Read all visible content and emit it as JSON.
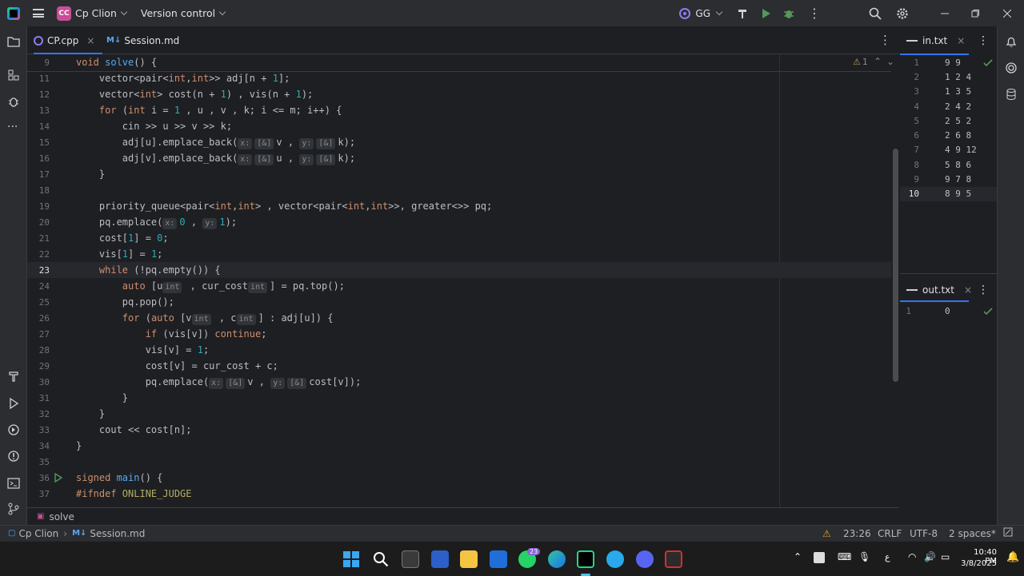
{
  "titlebar": {
    "project_badge": "CC",
    "project_name": "Cp Clion",
    "vcs": "Version control",
    "user_badge": "GG"
  },
  "tabs": [
    {
      "label": "CP.cpp",
      "active": true
    },
    {
      "label": "Session.md",
      "active": false
    }
  ],
  "editor": {
    "warning_count": "1",
    "line_numbers": [
      "9",
      "11",
      "12",
      "13",
      "14",
      "15",
      "16",
      "17",
      "18",
      "19",
      "20",
      "21",
      "22",
      "23",
      "24",
      "25",
      "26",
      "27",
      "28",
      "29",
      "30",
      "31",
      "32",
      "33",
      "34",
      "35",
      "36",
      "37"
    ],
    "current_line": "23"
  },
  "code": {
    "l9_a": "void ",
    "l9_fn": "solve",
    "l9_b": "() {",
    "l11_a": "    vector<pair<",
    "l11_b": "int",
    "l11_c": ",",
    "l11_d": "int",
    "l11_e": ">> adj[n + ",
    "l11_n": "1",
    "l11_f": "];",
    "l12_a": "    vector<",
    "l12_b": "int",
    "l12_c": "> cost(n + ",
    "l12_n": "1",
    "l12_d": ") , vis(n + ",
    "l12_n2": "1",
    "l12_e": ");",
    "l13_a": "    ",
    "l13_for": "for",
    "l13_b": " (",
    "l13_int": "int",
    "l13_c": " i = ",
    "l13_n": "1",
    "l13_d": " , u , v , k; i <= m; i++) {",
    "l14": "        cin >> u >> v >> k;",
    "l15_a": "        adj[u].emplace_back(",
    "l15_h1": "x:",
    "l15_h2": "[&]",
    "l15_b": "v , ",
    "l15_h3": "y:",
    "l15_h4": "[&]",
    "l15_c": "k);",
    "l16_a": "        adj[v].emplace_back(",
    "l16_h1": "x:",
    "l16_h2": "[&]",
    "l16_b": "u , ",
    "l16_h3": "y:",
    "l16_h4": "[&]",
    "l16_c": "k);",
    "l17": "    }",
    "l19_a": "    priority_queue<pair<",
    "l19_b": "int",
    "l19_c": ",",
    "l19_d": "int",
    "l19_e": "> , vector<pair<",
    "l19_f": "int",
    "l19_g": ",",
    "l19_h": "int",
    "l19_i": ">>, greater<>> pq;",
    "l20_a": "    pq.emplace(",
    "l20_h1": "x:",
    "l20_n": "0",
    "l20_b": " , ",
    "l20_h2": "y:",
    "l20_n2": "1",
    "l20_c": ");",
    "l21_a": "    cost[",
    "l21_n": "1",
    "l21_b": "] = ",
    "l21_n2": "0",
    "l21_c": ";",
    "l22_a": "    vis[",
    "l22_n": "1",
    "l22_b": "] = ",
    "l22_n2": "1",
    "l22_c": ";",
    "l23_a": "    ",
    "l23_kw": "while",
    "l23_b": " (!pq.empty()) {",
    "l24_a": "        ",
    "l24_kw": "auto",
    "l24_b": " [u",
    "l24_h1": "int",
    "l24_c": " , cur_cost",
    "l24_h2": "int",
    "l24_d": "] = pq.top();",
    "l25": "        pq.pop();",
    "l26_a": "        ",
    "l26_kw": "for",
    "l26_b": " (",
    "l26_kw2": "auto",
    "l26_c": " [v",
    "l26_h1": "int",
    "l26_d": " , c",
    "l26_h2": "int",
    "l26_e": "] : adj[u]) {",
    "l27_a": "            ",
    "l27_kw": "if",
    "l27_b": " (vis[v]) ",
    "l27_kw2": "continue",
    "l27_c": ";",
    "l28_a": "            vis[v] = ",
    "l28_n": "1",
    "l28_b": ";",
    "l29": "            cost[v] = cur_cost + c;",
    "l30_a": "            pq.emplace(",
    "l30_h1": "x:",
    "l30_h2": "[&]",
    "l30_b": "v , ",
    "l30_h3": "y:",
    "l30_h4": "[&]",
    "l30_c": "cost[v]);",
    "l31": "        }",
    "l32": "    }",
    "l33": "    cout << cost[n];",
    "l34": "}",
    "l36_kw": "signed ",
    "l36_fn": "main",
    "l36_b": "() {",
    "l37_a": "#ifndef ",
    "l37_b": "ONLINE_JUDGE"
  },
  "breadcrumb": {
    "item": "solve"
  },
  "in_panel": {
    "title": "in.txt",
    "lines": [
      "9 9",
      "1 2 4",
      "1 3 5",
      "2 4 2",
      "2 5 2",
      "2 6 8",
      "4 9 12",
      "5 8 6",
      "9 7 8",
      "8 9 5"
    ],
    "numbers": [
      "1",
      "2",
      "3",
      "4",
      "5",
      "6",
      "7",
      "8",
      "9",
      "10"
    ]
  },
  "out_panel": {
    "title": "out.txt",
    "lines": [
      "0"
    ],
    "numbers": [
      "1"
    ]
  },
  "statusbar": {
    "project": "Cp Clion",
    "file": "Session.md",
    "position": "23:26",
    "line_sep": "CRLF",
    "encoding": "UTF-8",
    "indent": "2 spaces*"
  },
  "taskbar": {
    "whatsapp_badge": "23",
    "time": "10:40 PM",
    "date": "3/8/2025",
    "lang": "ع"
  }
}
